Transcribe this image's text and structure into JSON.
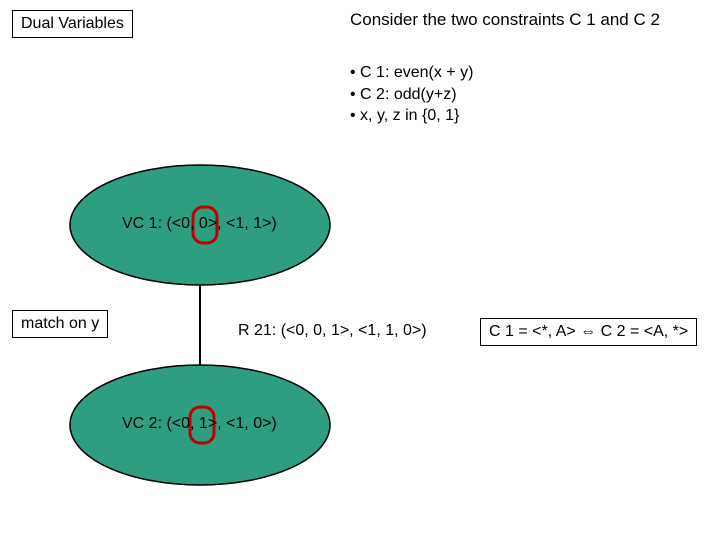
{
  "title": "Dual Variables",
  "intro": "Consider the two constraints C 1 and C 2",
  "constraints": {
    "c1": "C 1: even(x + y)",
    "c2": "C 2: odd(y+z)",
    "dom": "x, y, z in {0, 1}"
  },
  "nodes": {
    "vc1": "VC 1: (<0, 0>, <1, 1>)",
    "vc2": "VC 2: (<0, 1>, <1, 0>)"
  },
  "edge": {
    "label": "match on y",
    "r21": "R 21: (<0, 0, 1>, <1, 1, 0>)"
  },
  "equiv": "C 1 = <*, A> ⇔ C 2 = <A, *>",
  "colors": {
    "ellipse": "#2e9e80",
    "highlight": "#c00000"
  }
}
